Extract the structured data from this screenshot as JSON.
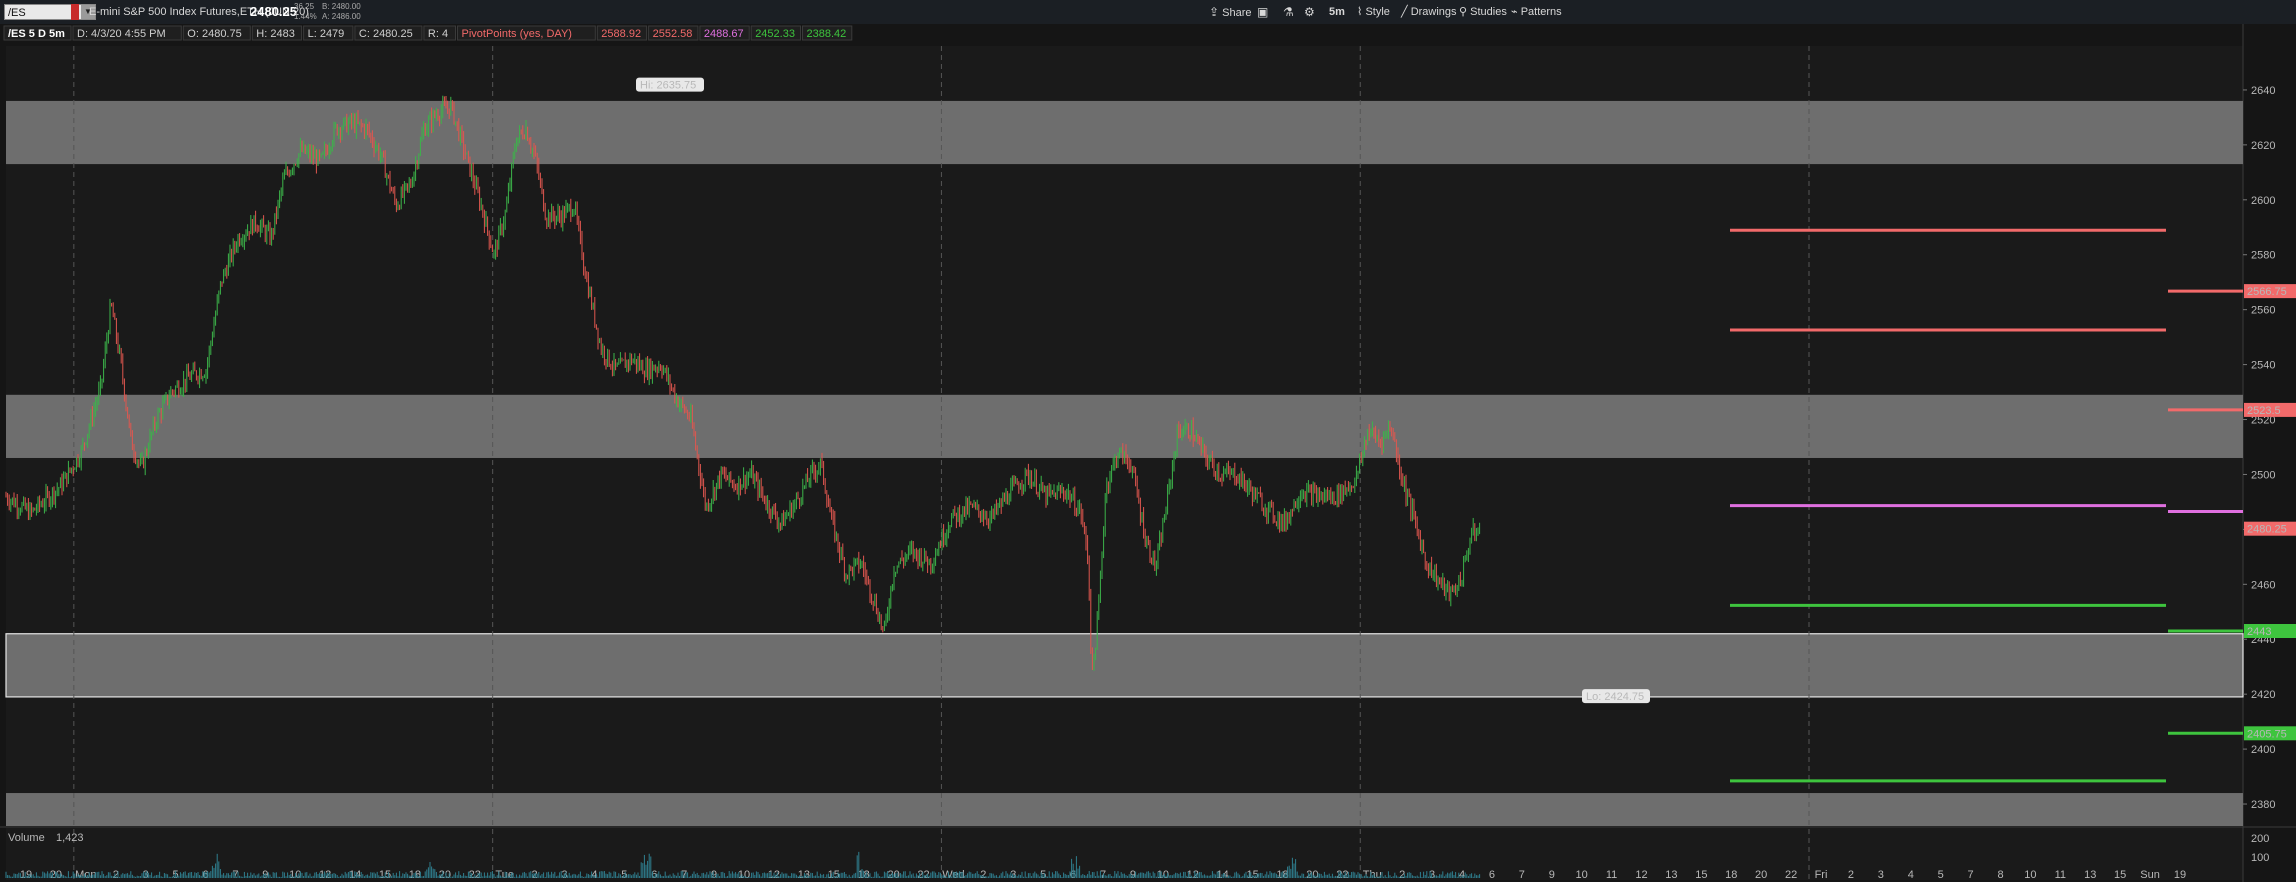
{
  "toolbar": {
    "symbol": "/ES",
    "instrument": "E-mini S&P 500 Index Futures,ETH (JUN 20)",
    "last_price": "2480.25",
    "change": "36.25",
    "change_pct": "1.44%",
    "bid": "B: 2480.00",
    "ask": "A: 2486.00",
    "share_label": "Share",
    "timeframe_label": "5m",
    "style_label": "Style",
    "drawings_label": "Drawings",
    "studies_label": "Studies",
    "patterns_label": "Patterns",
    "colors": {
      "accent": "#e44a4a",
      "toolbar_bg": "#1b1f24"
    }
  },
  "info_bar": {
    "title": "/ES 5 D 5m",
    "date": "D: 4/3/20 4:55 PM",
    "open": "O: 2480.75",
    "high": "H: 2483",
    "low": "L: 2479",
    "close": "C: 2480.25",
    "range": "R: 4",
    "study": "PivotPoints (yes, DAY)",
    "pivot_values": [
      {
        "text": "2588.92",
        "color": "#f26a6a"
      },
      {
        "text": "2552.58",
        "color": "#f26a6a"
      },
      {
        "text": "2488.67",
        "color": "#e070e0"
      },
      {
        "text": "2452.33",
        "color": "#3ec43e"
      },
      {
        "text": "2388.42",
        "color": "#3ec43e"
      }
    ]
  },
  "volume_pane": {
    "label": "Volume",
    "value": "1,423",
    "ticks": [
      "200",
      "100"
    ]
  },
  "annotations": {
    "high_label": "Hi: 2635.75",
    "low_label": "Lo: 2424.75"
  },
  "chart_data": {
    "type": "candlestick",
    "title": "/ES 5 D 5m",
    "ylim": [
      2372,
      2656
    ],
    "y_ticks": [
      2380,
      2400,
      2420,
      2440,
      2460,
      2480,
      2500,
      2520,
      2540,
      2560,
      2580,
      2600,
      2620,
      2640
    ],
    "x_labels": [
      "19",
      "20",
      "Mon",
      "2",
      "3",
      "5",
      "6",
      "7",
      "9",
      "10",
      "12",
      "14",
      "15",
      "18",
      "20",
      "22",
      "Tue",
      "2",
      "3",
      "4",
      "5",
      "6",
      "7",
      "9",
      "10",
      "12",
      "13",
      "15",
      "18",
      "20",
      "22",
      "Wed",
      "2",
      "3",
      "5",
      "6",
      "7",
      "9",
      "10",
      "12",
      "14",
      "15",
      "18",
      "20",
      "22",
      "Thu",
      "2",
      "3",
      "4",
      "6",
      "7",
      "9",
      "10",
      "11",
      "12",
      "13",
      "15",
      "18",
      "20",
      "22",
      "Fri",
      "2",
      "3",
      "4",
      "5",
      "7",
      "8",
      "10",
      "11",
      "13",
      "15",
      "Sun",
      "19"
    ],
    "day_separators": [
      "Mon",
      "Tue",
      "Wed",
      "Thu",
      "Fri"
    ],
    "zones": [
      {
        "name": "upper-resistance-zone",
        "from": 2613,
        "to": 2636
      },
      {
        "name": "middle-zone",
        "from": 2506,
        "to": 2529
      },
      {
        "name": "lower-support-zone",
        "from": 2419,
        "to": 2442
      },
      {
        "name": "bottom-zone",
        "from": 2372,
        "to": 2384
      }
    ],
    "pivot_lines": [
      {
        "value": 2588.92,
        "color": "#f26a6a"
      },
      {
        "value": 2552.58,
        "color": "#f26a6a"
      },
      {
        "value": 2488.67,
        "color": "#e070e0"
      },
      {
        "value": 2452.33,
        "color": "#3ec43e"
      },
      {
        "value": 2388.42,
        "color": "#3ec43e"
      }
    ],
    "projected_levels": [
      {
        "value": 2566.75,
        "label": "2566.75",
        "color": "#f26a6a"
      },
      {
        "value": 2523.5,
        "label": "2523.5",
        "color": "#f26a6a"
      },
      {
        "value": 2486.5,
        "label": "",
        "color": "#e070e0"
      },
      {
        "value": 2443,
        "label": "2443",
        "color": "#3ec43e"
      },
      {
        "value": 2405.75,
        "label": "2405.75",
        "color": "#3ec43e"
      }
    ],
    "price_marker": {
      "value": 2480.25,
      "label": "2480.25",
      "color": "#f26a6a"
    },
    "price_path": [
      [
        0,
        2492
      ],
      [
        25,
        2486
      ],
      [
        55,
        2496
      ],
      [
        75,
        2508
      ],
      [
        95,
        2532
      ],
      [
        105,
        2562
      ],
      [
        115,
        2540
      ],
      [
        125,
        2512
      ],
      [
        135,
        2502
      ],
      [
        150,
        2520
      ],
      [
        165,
        2530
      ],
      [
        185,
        2536
      ],
      [
        200,
        2538
      ],
      [
        215,
        2570
      ],
      [
        232,
        2586
      ],
      [
        250,
        2592
      ],
      [
        265,
        2586
      ],
      [
        278,
        2608
      ],
      [
        295,
        2618
      ],
      [
        315,
        2614
      ],
      [
        330,
        2626
      ],
      [
        345,
        2628
      ],
      [
        360,
        2626
      ],
      [
        375,
        2616
      ],
      [
        390,
        2598
      ],
      [
        405,
        2606
      ],
      [
        418,
        2626
      ],
      [
        432,
        2632
      ],
      [
        445,
        2634
      ],
      [
        460,
        2616
      ],
      [
        475,
        2598
      ],
      [
        488,
        2580
      ],
      [
        500,
        2596
      ],
      [
        510,
        2622
      ],
      [
        520,
        2626
      ],
      [
        530,
        2614
      ],
      [
        540,
        2594
      ],
      [
        555,
        2594
      ],
      [
        568,
        2598
      ],
      [
        580,
        2572
      ],
      [
        595,
        2546
      ],
      [
        610,
        2538
      ],
      [
        625,
        2542
      ],
      [
        640,
        2538
      ],
      [
        655,
        2540
      ],
      [
        670,
        2528
      ],
      [
        685,
        2520
      ],
      [
        700,
        2488
      ],
      [
        715,
        2500
      ],
      [
        730,
        2496
      ],
      [
        745,
        2500
      ],
      [
        760,
        2490
      ],
      [
        775,
        2482
      ],
      [
        790,
        2490
      ],
      [
        805,
        2500
      ],
      [
        815,
        2504
      ],
      [
        825,
        2484
      ],
      [
        840,
        2464
      ],
      [
        855,
        2468
      ],
      [
        870,
        2452
      ],
      [
        878,
        2442
      ],
      [
        888,
        2466
      ],
      [
        905,
        2472
      ],
      [
        925,
        2468
      ],
      [
        945,
        2484
      ],
      [
        965,
        2488
      ],
      [
        985,
        2484
      ],
      [
        1005,
        2494
      ],
      [
        1022,
        2500
      ],
      [
        1040,
        2492
      ],
      [
        1060,
        2494
      ],
      [
        1075,
        2486
      ],
      [
        1082,
        2470
      ],
      [
        1086,
        2426
      ],
      [
        1092,
        2448
      ],
      [
        1100,
        2496
      ],
      [
        1112,
        2508
      ],
      [
        1125,
        2504
      ],
      [
        1140,
        2476
      ],
      [
        1150,
        2466
      ],
      [
        1160,
        2488
      ],
      [
        1172,
        2516
      ],
      [
        1185,
        2516
      ],
      [
        1200,
        2506
      ],
      [
        1215,
        2500
      ],
      [
        1230,
        2500
      ],
      [
        1245,
        2494
      ],
      [
        1260,
        2488
      ],
      [
        1278,
        2482
      ],
      [
        1295,
        2494
      ],
      [
        1312,
        2492
      ],
      [
        1330,
        2492
      ],
      [
        1350,
        2498
      ],
      [
        1362,
        2516
      ],
      [
        1375,
        2512
      ],
      [
        1385,
        2518
      ],
      [
        1395,
        2500
      ],
      [
        1408,
        2484
      ],
      [
        1420,
        2468
      ],
      [
        1435,
        2460
      ],
      [
        1445,
        2456
      ],
      [
        1455,
        2462
      ],
      [
        1465,
        2478
      ],
      [
        1475,
        2480
      ]
    ]
  }
}
